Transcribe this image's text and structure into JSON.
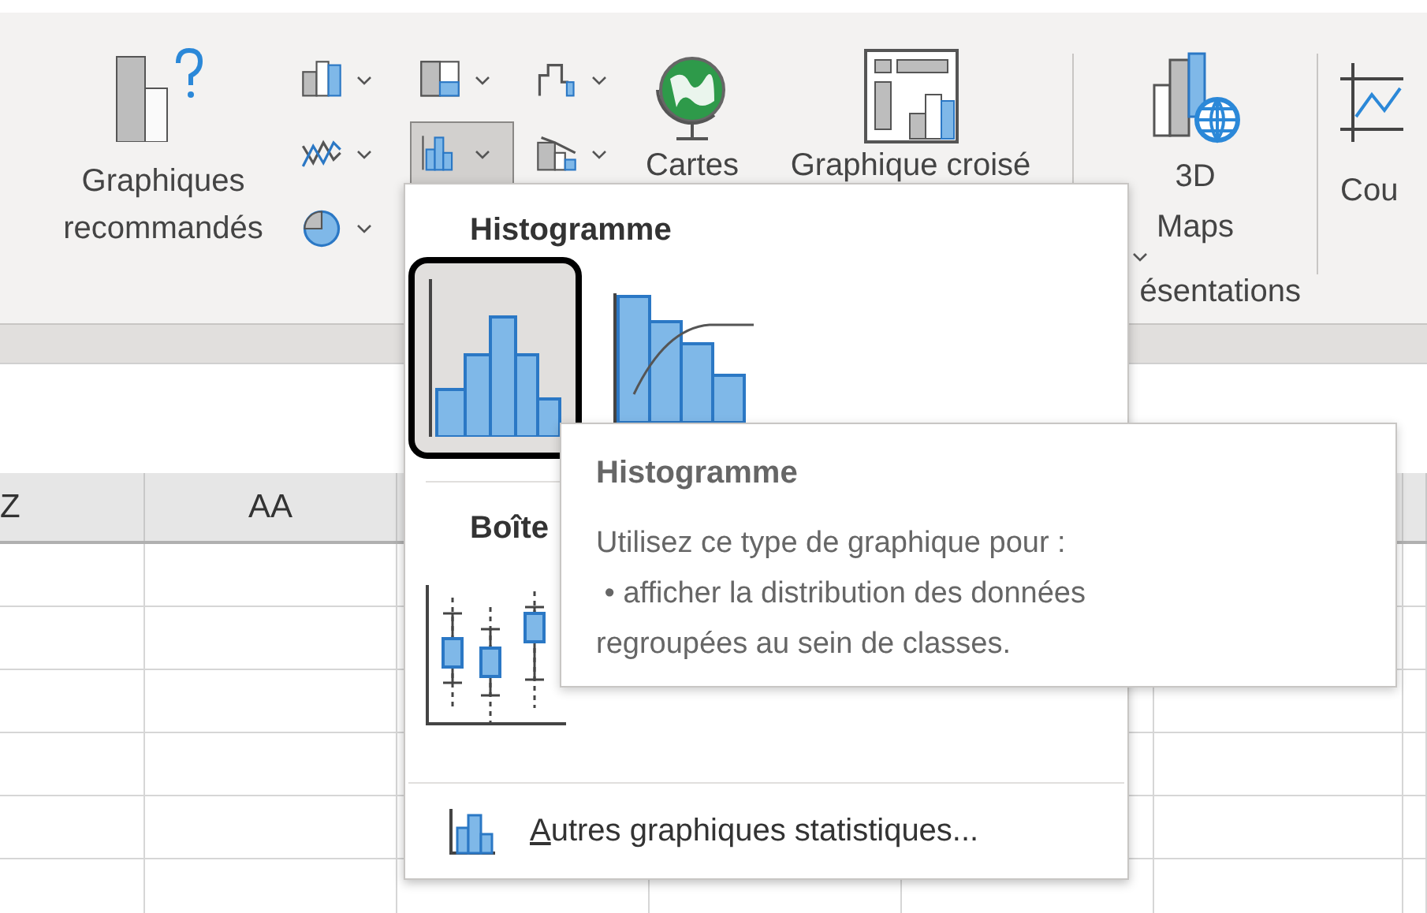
{
  "ribbon": {
    "recommended": {
      "label": "Graphiques recommandés"
    },
    "chart_buttons": [
      {
        "kind": "column",
        "selected": false
      },
      {
        "kind": "treemap",
        "selected": false
      },
      {
        "kind": "waterfall",
        "selected": false
      },
      {
        "kind": "line",
        "selected": false
      },
      {
        "kind": "histogram",
        "selected": true
      },
      {
        "kind": "combo",
        "selected": false
      },
      {
        "kind": "pie",
        "selected": false
      }
    ],
    "maps": {
      "label": "Cartes"
    },
    "pivot": {
      "label": "Graphique croisé"
    },
    "maps3d": {
      "label": "3D Maps"
    },
    "group_label": "ésentations",
    "partial_button": {
      "label": "Cou"
    }
  },
  "sheet": {
    "columns": [
      "Z",
      "AA"
    ]
  },
  "menu": {
    "sections": [
      {
        "title": "Histogramme",
        "items": [
          {
            "kind": "histogram",
            "selected": true
          },
          {
            "kind": "pareto",
            "selected": false
          }
        ]
      },
      {
        "title": "Boîte",
        "items": [
          {
            "kind": "boxplot",
            "selected": false
          }
        ]
      }
    ],
    "footer": {
      "label": "Autres graphiques statistiques..."
    }
  },
  "tooltip": {
    "title": "Histogramme",
    "lines": [
      "Utilisez ce type de graphique pour :",
      " • afficher la distribution des données",
      "regroupées au sein de classes."
    ]
  }
}
